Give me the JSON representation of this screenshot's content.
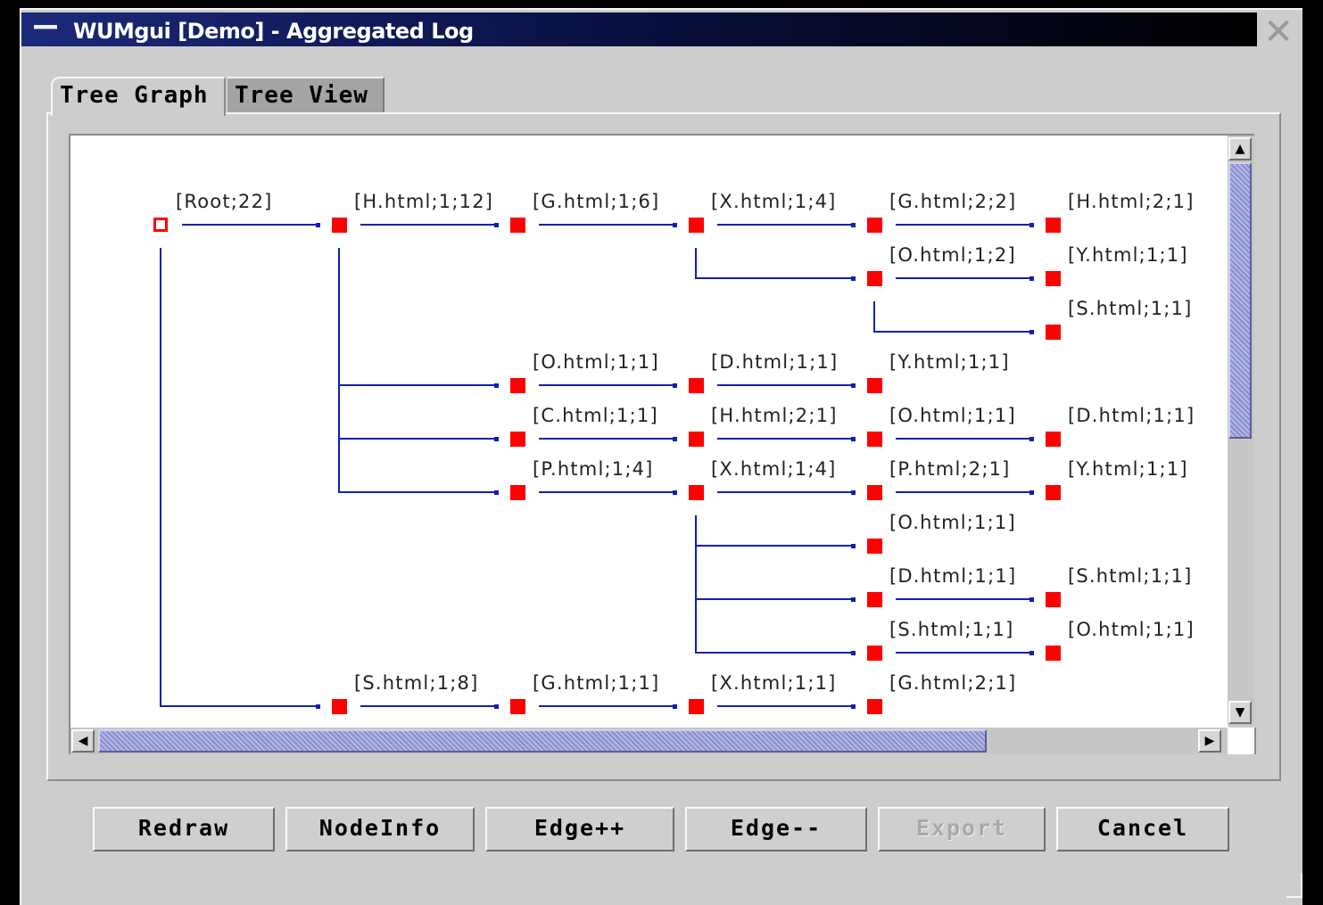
{
  "window": {
    "title": "WUMgui [Demo] - Aggregated Log",
    "menu_icon": "dash-icon",
    "close_icon": "close-x-icon"
  },
  "tabs": [
    {
      "label": "Tree Graph",
      "selected": true
    },
    {
      "label": "Tree View",
      "selected": false
    }
  ],
  "colors": {
    "node_fill": "#ff0000",
    "edge": "#1020b0",
    "scroll_thumb": "#9ea2d8"
  },
  "graph": {
    "nodes": [
      {
        "label": "[Root;22]",
        "col": 0,
        "row": 0,
        "root": true
      },
      {
        "label": "[H.html;1;12]",
        "col": 1,
        "row": 0
      },
      {
        "label": "[G.html;1;6]",
        "col": 2,
        "row": 0
      },
      {
        "label": "[X.html;1;4]",
        "col": 3,
        "row": 0
      },
      {
        "label": "[G.html;2;2]",
        "col": 4,
        "row": 0
      },
      {
        "label": "[H.html;2;1]",
        "col": 5,
        "row": 0
      },
      {
        "label": "[O.html;1;2]",
        "col": 4,
        "row": 1
      },
      {
        "label": "[Y.html;1;1]",
        "col": 5,
        "row": 1
      },
      {
        "label": "[S.html;1;1]",
        "col": 5,
        "row": 2
      },
      {
        "label": "[O.html;1;1]",
        "col": 2,
        "row": 3
      },
      {
        "label": "[D.html;1;1]",
        "col": 3,
        "row": 3
      },
      {
        "label": "[Y.html;1;1]",
        "col": 4,
        "row": 3
      },
      {
        "label": "[C.html;1;1]",
        "col": 2,
        "row": 4
      },
      {
        "label": "[H.html;2;1]",
        "col": 3,
        "row": 4
      },
      {
        "label": "[O.html;1;1]",
        "col": 4,
        "row": 4
      },
      {
        "label": "[D.html;1;1]",
        "col": 5,
        "row": 4
      },
      {
        "label": "[P.html;1;4]",
        "col": 2,
        "row": 5
      },
      {
        "label": "[X.html;1;4]",
        "col": 3,
        "row": 5
      },
      {
        "label": "[P.html;2;1]",
        "col": 4,
        "row": 5
      },
      {
        "label": "[Y.html;1;1]",
        "col": 5,
        "row": 5
      },
      {
        "label": "[O.html;1;1]",
        "col": 4,
        "row": 6
      },
      {
        "label": "[D.html;1;1]",
        "col": 4,
        "row": 7
      },
      {
        "label": "[S.html;1;1]",
        "col": 5,
        "row": 7
      },
      {
        "label": "[S.html;1;1]",
        "col": 4,
        "row": 8
      },
      {
        "label": "[O.html;1;1]",
        "col": 5,
        "row": 8
      },
      {
        "label": "[S.html;1;8]",
        "col": 1,
        "row": 9
      },
      {
        "label": "[G.html;1;1]",
        "col": 2,
        "row": 9
      },
      {
        "label": "[X.html;1;1]",
        "col": 3,
        "row": 9
      },
      {
        "label": "[G.html;2;1]",
        "col": 4,
        "row": 9
      }
    ],
    "edges": [
      [
        0,
        1
      ],
      [
        1,
        2
      ],
      [
        2,
        3
      ],
      [
        3,
        4
      ],
      [
        4,
        5
      ],
      [
        3,
        6
      ],
      [
        6,
        7
      ],
      [
        6,
        8
      ],
      [
        1,
        9
      ],
      [
        9,
        10
      ],
      [
        10,
        11
      ],
      [
        1,
        12
      ],
      [
        12,
        13
      ],
      [
        13,
        14
      ],
      [
        14,
        15
      ],
      [
        1,
        16
      ],
      [
        16,
        17
      ],
      [
        17,
        18
      ],
      [
        18,
        19
      ],
      [
        17,
        20
      ],
      [
        17,
        21
      ],
      [
        21,
        22
      ],
      [
        17,
        23
      ],
      [
        23,
        24
      ],
      [
        0,
        25
      ],
      [
        25,
        26
      ],
      [
        26,
        27
      ],
      [
        27,
        28
      ]
    ]
  },
  "scrollbars": {
    "up_arrow": "▲",
    "down_arrow": "▼",
    "left_arrow": "◀",
    "right_arrow": "▶",
    "vertical_position": 0.0,
    "horizontal_position": 0.0
  },
  "buttons": {
    "redraw": "Redraw",
    "nodeinfo": "NodeInfo",
    "edge_plus": "Edge++",
    "edge_minus": "Edge--",
    "export": "Export",
    "cancel": "Cancel"
  }
}
